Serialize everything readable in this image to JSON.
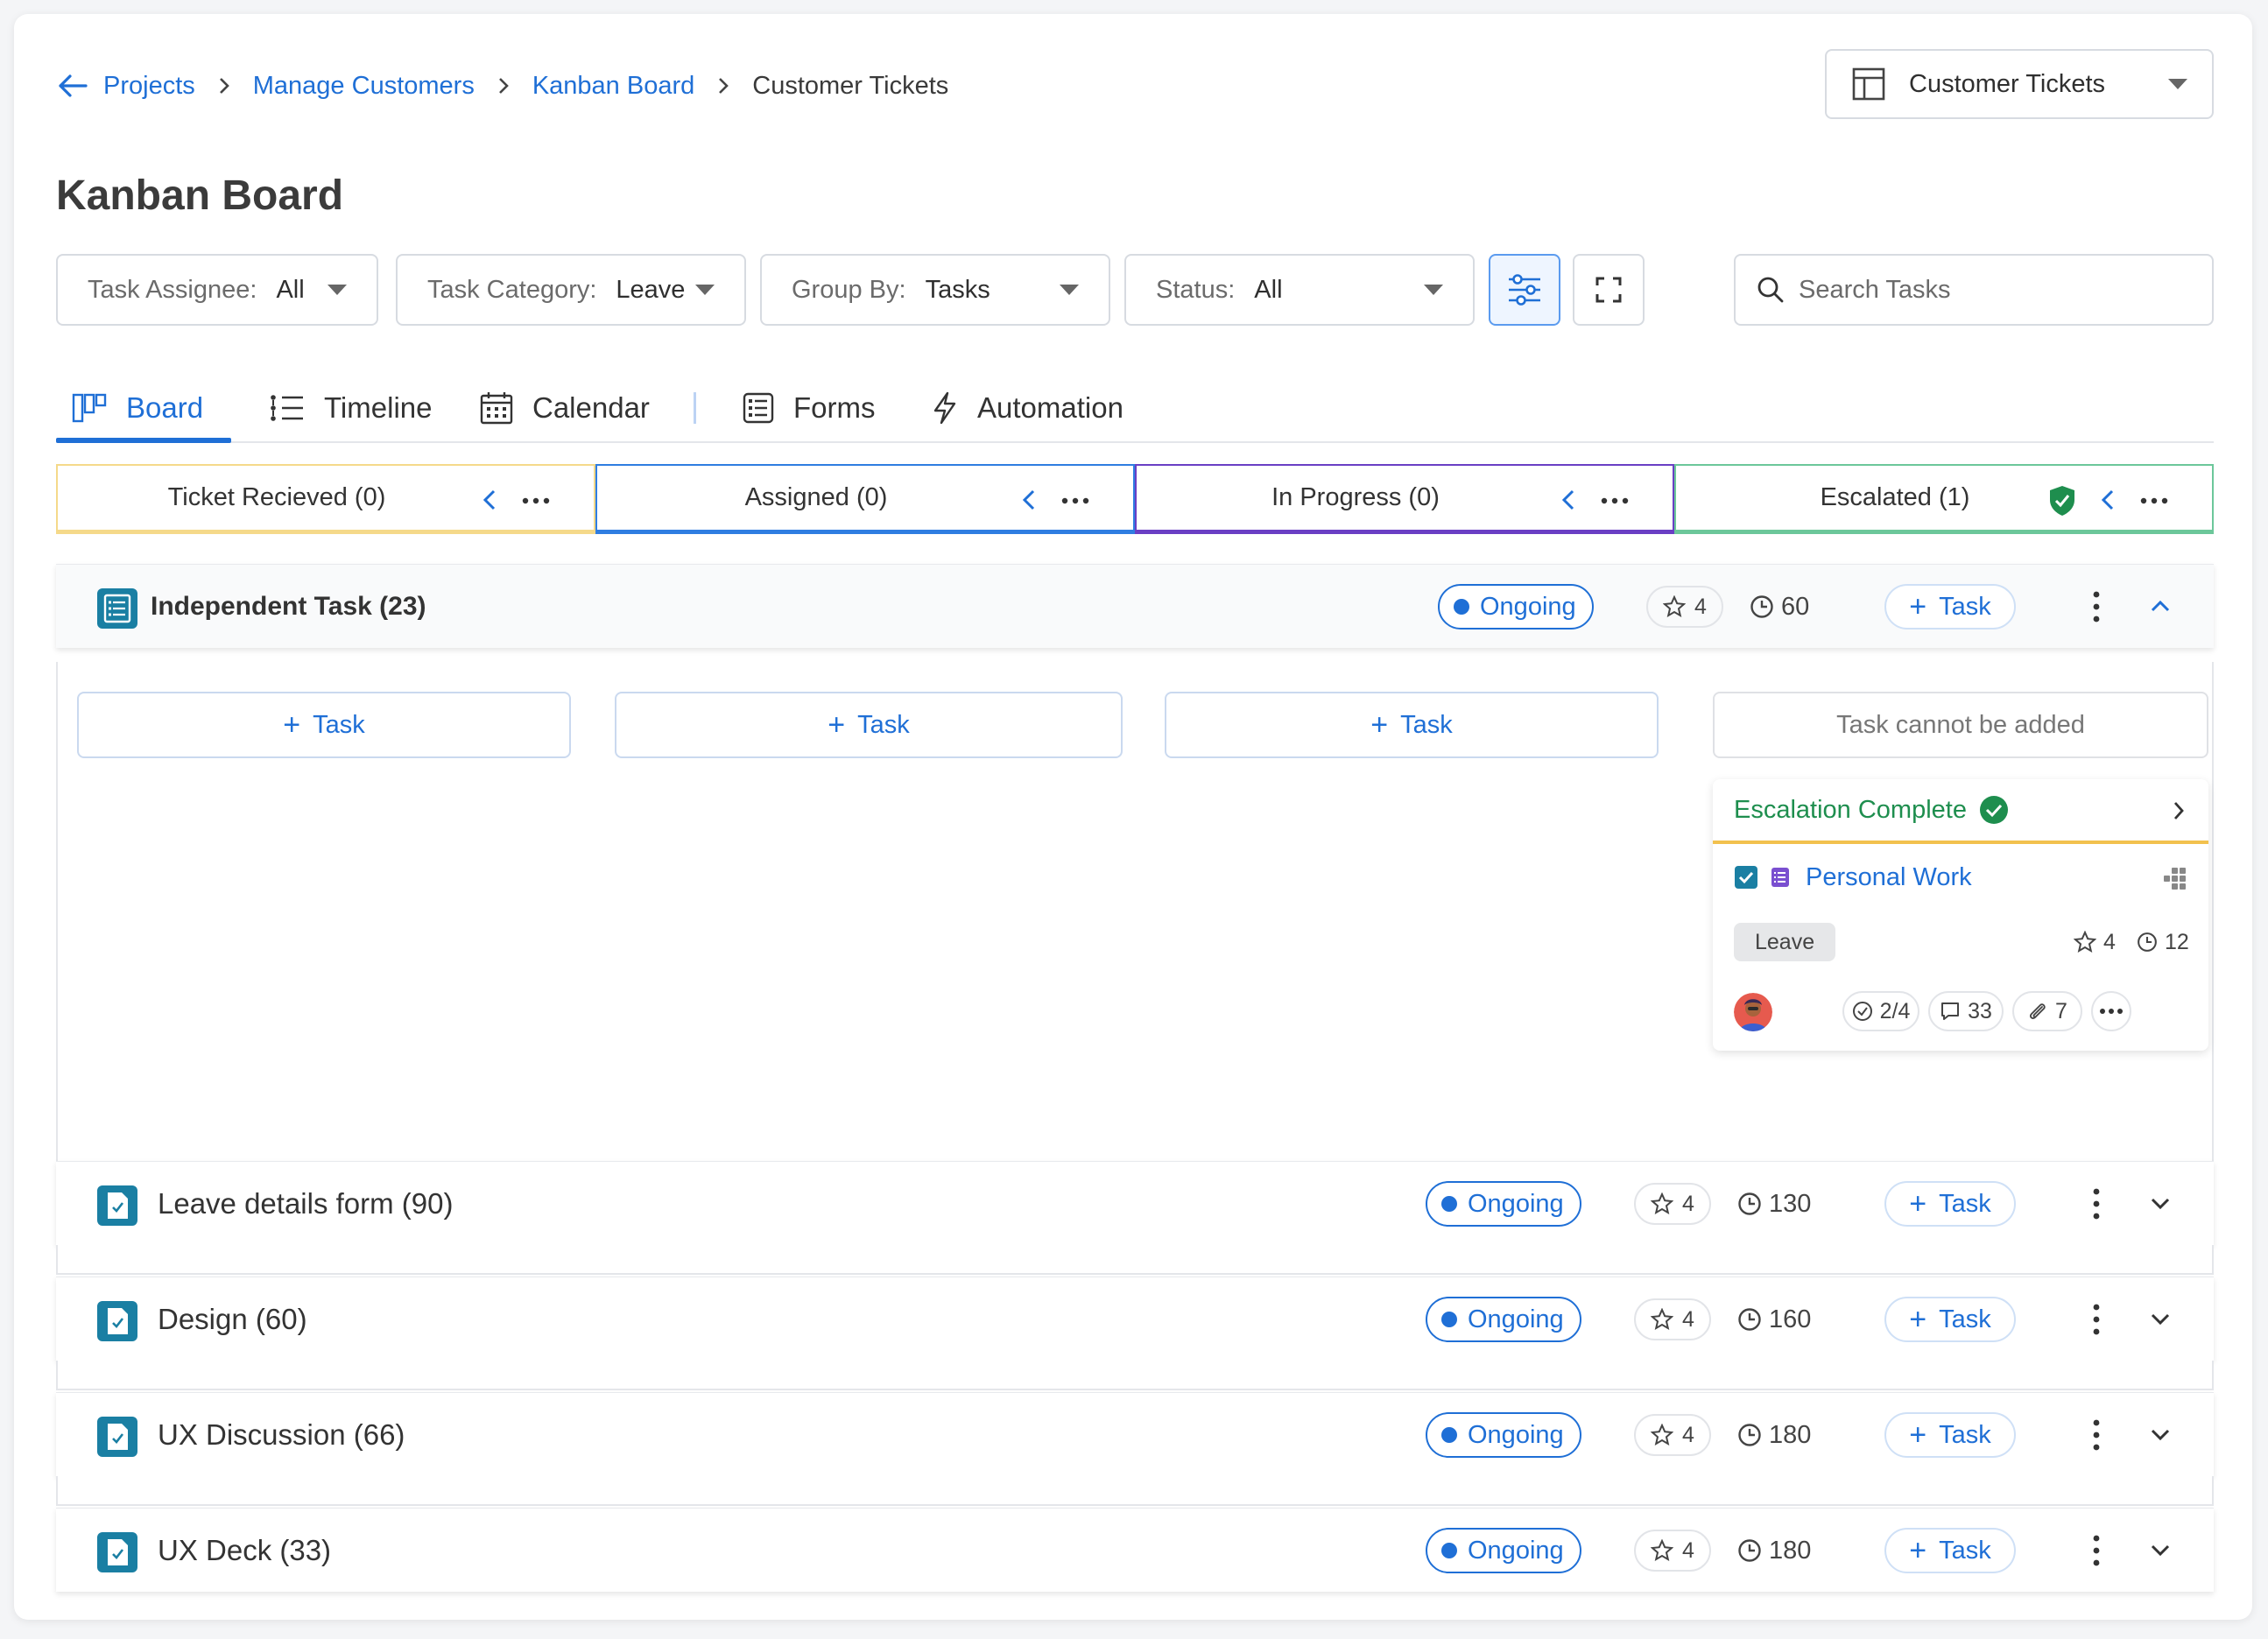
{
  "breadcrumb": {
    "items": [
      "Projects",
      "Manage Customers",
      "Kanban Board"
    ],
    "current": "Customer Tickets"
  },
  "view_selector": {
    "label": "Customer Tickets"
  },
  "page_title": "Kanban Board",
  "filters": [
    {
      "key": "Task Assignee:",
      "value": "All"
    },
    {
      "key": "Task Category:",
      "value": "Leave"
    },
    {
      "key": "Group By:",
      "value": "Tasks"
    },
    {
      "key": "Status:",
      "value": "All"
    }
  ],
  "search": {
    "placeholder": "Search Tasks"
  },
  "tabs": [
    {
      "label": "Board",
      "icon": "board-icon",
      "active": true
    },
    {
      "label": "Timeline",
      "icon": "timeline-icon"
    },
    {
      "label": "Calendar",
      "icon": "calendar-icon"
    },
    {
      "label": "Forms",
      "icon": "forms-icon"
    },
    {
      "label": "Automation",
      "icon": "automation-icon"
    }
  ],
  "columns": [
    {
      "name": "Ticket Recieved (0)",
      "color": "#f5d98a"
    },
    {
      "name": "Assigned (0)",
      "color": "#2f7de1"
    },
    {
      "name": "In Progress (0)",
      "color": "#6a3fc4"
    },
    {
      "name": "Escalated (1)",
      "color": "#6cc79a"
    }
  ],
  "groups": [
    {
      "title": "Independent Task (23)",
      "status": "Ongoing",
      "stars": "4",
      "time": "60",
      "task_label": "Task",
      "expanded": true
    },
    {
      "title": "Leave details form (90)",
      "status": "Ongoing",
      "stars": "4",
      "time": "130",
      "task_label": "Task"
    },
    {
      "title": "Design (60)",
      "status": "Ongoing",
      "stars": "4",
      "time": "160",
      "task_label": "Task"
    },
    {
      "title": "UX Discussion (66)",
      "status": "Ongoing",
      "stars": "4",
      "time": "180",
      "task_label": "Task"
    },
    {
      "title": "UX Deck (33)",
      "status": "Ongoing",
      "stars": "4",
      "time": "180",
      "task_label": "Task"
    }
  ],
  "add_task": {
    "label": "Task",
    "disabled_label": "Task cannot be added"
  },
  "ticket": {
    "status": "Escalation Complete",
    "title": "Personal Work",
    "tag": "Leave",
    "stars": "4",
    "time": "12",
    "checklist": "2/4",
    "comments": "33",
    "attachments": "7"
  },
  "colors": {
    "accent": "#1f6fd6",
    "success": "#1e8e4e",
    "ticket_border": "#f2c14e"
  }
}
